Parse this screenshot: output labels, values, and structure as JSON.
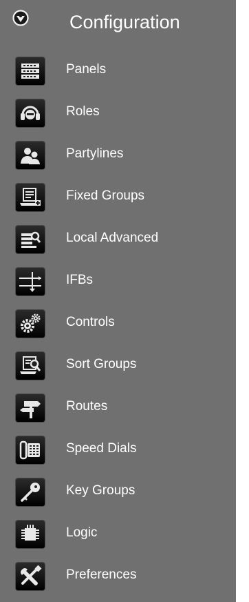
{
  "header": {
    "title": "Configuration",
    "icon": "configuration-badge-icon"
  },
  "colors": {
    "panel_background": "#707070",
    "text": "#ffffff",
    "icon_tile": "#111111"
  },
  "nav": {
    "items": [
      {
        "label": "Panels",
        "icon": "panels-icon"
      },
      {
        "label": "Roles",
        "icon": "headset-icon"
      },
      {
        "label": "Partylines",
        "icon": "people-icon"
      },
      {
        "label": "Fixed Groups",
        "icon": "fixed-groups-icon"
      },
      {
        "label": "Local Advanced",
        "icon": "local-advanced-icon"
      },
      {
        "label": "IFBs",
        "icon": "ifb-icon"
      },
      {
        "label": "Controls",
        "icon": "gears-icon"
      },
      {
        "label": "Sort Groups",
        "icon": "sort-groups-icon"
      },
      {
        "label": "Routes",
        "icon": "signpost-icon"
      },
      {
        "label": "Speed Dials",
        "icon": "phone-icon"
      },
      {
        "label": "Key Groups",
        "icon": "key-icon"
      },
      {
        "label": "Logic",
        "icon": "chip-icon"
      },
      {
        "label": "Preferences",
        "icon": "tools-icon"
      }
    ]
  }
}
